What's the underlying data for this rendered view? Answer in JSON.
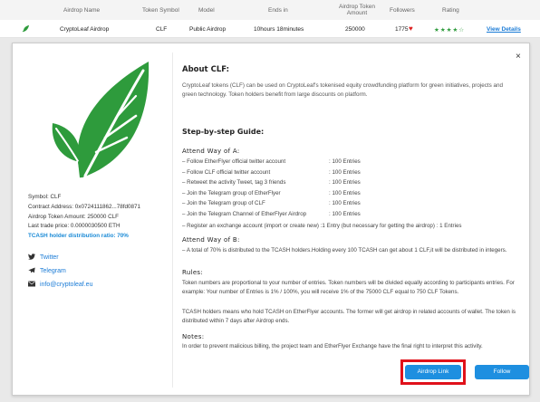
{
  "table": {
    "headers": [
      "Airdrop Name",
      "Token Symbol",
      "Model",
      "Ends in",
      "Airdrop Token Amount",
      "Followers",
      "Rating"
    ],
    "row": {
      "name": "CryptoLeaf Airdrop",
      "symbol": "CLF",
      "model": "Public Airdrop",
      "ends_in": "10hours 18minutes",
      "amount": "250000",
      "followers": "1775",
      "rating": "★★★★☆",
      "rating_value": 4,
      "details": "View Details"
    }
  },
  "modal": {
    "close": "×",
    "info": {
      "symbol": "Symbol: CLF",
      "contract": "Contract Address: 0x0724111862...78fd0871",
      "amount": "Airdrop Token Amount: 250000 CLF",
      "price": "Last trade price: 0.0000030500 ETH",
      "ratio": "TCASH holder distribution ratio: 70%"
    },
    "social": {
      "twitter": "Twitter",
      "telegram": "Telegram",
      "email": "info@cryptoleaf.eu"
    },
    "about_title": "About CLF:",
    "about_text": "CryptoLeaf tokens (CLF) can be used on CryptoLeaf's tokenised equity crowdfunding platform for green initiatives, projects and green technology. Token holders benefit from large discounts on platform.",
    "guide_title": "Step-by-step Guide:",
    "way_a_title": "Attend Way of A:",
    "way_a_tasks": [
      {
        "task": "– Follow EtherFlyer official twitter account",
        "entry": ":   100 Entries"
      },
      {
        "task": "– Follow CLF official twitter account",
        "entry": ":   100 Entries"
      },
      {
        "task": "– Retweet the activity Tweet, tag 3 friends",
        "entry": ":   100 Entries"
      },
      {
        "task": "– Join the Telegram group of EtherFlyer",
        "entry": ":   100 Entries"
      },
      {
        "task": "– Join the Telegram group of CLF",
        "entry": ":   100 Entries"
      },
      {
        "task": "– Join the Telegram Channel of EtherFlyer Airdrop",
        "entry": ":   100 Entries"
      }
    ],
    "way_a_register": "– Register an exchange account (import or create new) :1 Entry (but necessary for getting the airdrop)   :  1 Entries",
    "way_b_title": "Attend Way of B:",
    "way_b_text": "– A total of 70% is distributed to the TCASH holders.Holding every 100 TCASH can get about 1 CLF,it will be distributed in integers.",
    "rules_title": "Rules:",
    "rules_text": "Token numbers are proportional to your number of entries. Token numbers will be divided equally according to participants entries. For example: Your number of Entries is 1% / 100%, you will receive 1% of the 75000 CLF equal to 750 CLF Tokens.",
    "rules_text2": "TCASH holders means who hold TCASH on EtherFlyer accounts. The former will get airdrop in related accounts of wallet. The token is distributed within 7 days after Airdrop ends.",
    "notes_title": "Notes:",
    "notes_text": "In order to prevent malicious billing, the project team and EtherFlyer Exchange have the final right to interpret this activity.",
    "buttons": {
      "airdrop": "Airdrop Link",
      "follow": "Follow"
    }
  },
  "colors": {
    "accent": "#1e8fe0",
    "leaf": "#2e9b3c",
    "highlight": "#e0111a"
  }
}
